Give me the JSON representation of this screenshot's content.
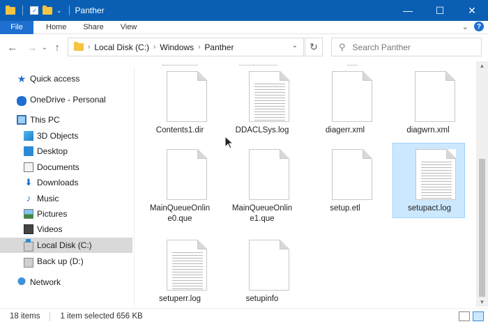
{
  "window": {
    "title": "Panther",
    "min_glyph": "—",
    "max_glyph": "☐",
    "close_glyph": "✕"
  },
  "ribbon": {
    "tabs": [
      "File",
      "Home",
      "Share",
      "View"
    ],
    "expand_glyph": "⌄",
    "help_glyph": "?"
  },
  "address": {
    "back_glyph": "←",
    "forward_glyph": "→",
    "recent_glyph": "⌄",
    "up_glyph": "↑",
    "crumbs": [
      "Local Disk (C:)",
      "Windows",
      "Panther"
    ],
    "sep_glyph": "›",
    "dropdown_glyph": "⌄",
    "refresh_glyph": "↻"
  },
  "search": {
    "placeholder": "Search Panther",
    "icon_glyph": "⚲"
  },
  "sidebar": {
    "items": [
      {
        "label": "Quick access",
        "icon": "star-icon"
      },
      {
        "label": "OneDrive - Personal",
        "icon": "cloud-icon"
      },
      {
        "label": "This PC",
        "icon": "computer-icon"
      },
      {
        "label": "3D Objects",
        "icon": "cube-icon"
      },
      {
        "label": "Desktop",
        "icon": "desktop-icon"
      },
      {
        "label": "Documents",
        "icon": "documents-icon"
      },
      {
        "label": "Downloads",
        "icon": "download-icon"
      },
      {
        "label": "Music",
        "icon": "music-icon"
      },
      {
        "label": "Pictures",
        "icon": "pictures-icon"
      },
      {
        "label": "Videos",
        "icon": "videos-icon"
      },
      {
        "label": "Local Disk (C:)",
        "icon": "drive-icon"
      },
      {
        "label": "Back up (D:)",
        "icon": "drive-icon"
      },
      {
        "label": "Network",
        "icon": "network-icon"
      }
    ]
  },
  "files": [
    {
      "line1": "Contents1.dir",
      "line2": "",
      "lined": false
    },
    {
      "line1": "DDACLSys.log",
      "line2": "",
      "lined": true
    },
    {
      "line1": "diagerr.xml",
      "line2": "",
      "lined": false
    },
    {
      "line1": "diagwrn.xml",
      "line2": "",
      "lined": false
    },
    {
      "line1": "MainQueueOnlin",
      "line2": "e0.que",
      "lined": false
    },
    {
      "line1": "MainQueueOnlin",
      "line2": "e1.que",
      "lined": false
    },
    {
      "line1": "setup.etl",
      "line2": "",
      "lined": false
    },
    {
      "line1": "setupact.log",
      "line2": "",
      "lined": true,
      "selected": true
    },
    {
      "line1": "setuperr.log",
      "line2": "",
      "lined": true
    },
    {
      "line1": "setupinfo",
      "line2": "",
      "lined": false
    }
  ],
  "status": {
    "count": "18 items",
    "selection": "1 item selected  656 KB"
  },
  "scroll": {
    "up_glyph": "▲",
    "down_glyph": "▼"
  },
  "colors": {
    "titlebar": "#0a5fb4",
    "file_tab": "#1e6fd1",
    "selection": "#cce8ff"
  }
}
